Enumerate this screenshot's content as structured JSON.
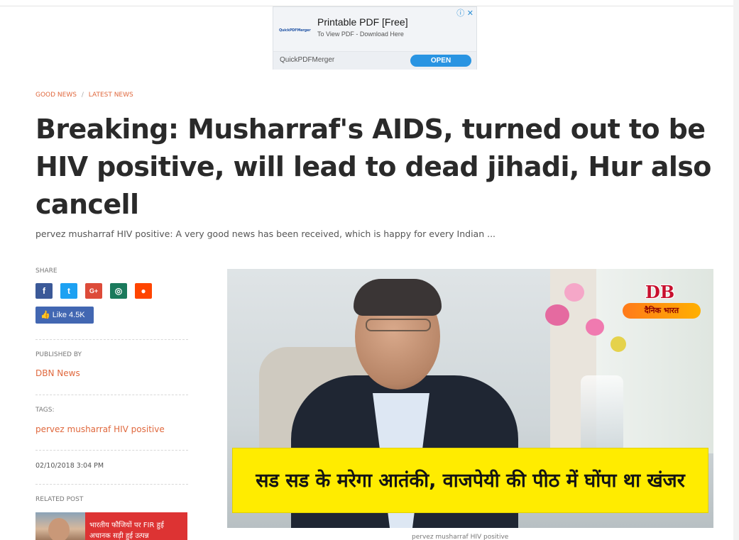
{
  "ad": {
    "logo_text": "QuickPDFMerger",
    "title": "Printable PDF [Free]",
    "subtitle": "To View PDF - Download Here",
    "info_icon": "info-icon",
    "close_icon": "close-icon",
    "brand": "QuickPDFMerger",
    "cta": "OPEN"
  },
  "breadcrumb": {
    "items": [
      "GOOD NEWS",
      "LATEST NEWS"
    ],
    "separator": "/"
  },
  "article": {
    "headline": "Breaking: Musharraf's AIDS, turned out to be HIV positive, will lead to dead jihadi, Hur also cancell",
    "summary": "pervez musharraf HIV positive: A very good news has been received, which is happy for every Indian ..."
  },
  "sidebar": {
    "share_label": "SHARE",
    "share_icons": [
      {
        "name": "facebook-icon",
        "glyph": "f",
        "color": "#3b5998"
      },
      {
        "name": "twitter-icon",
        "glyph": "t",
        "color": "#1da1f2"
      },
      {
        "name": "google-plus-icon",
        "glyph": "G+",
        "color": "#dd4b39"
      },
      {
        "name": "whatsapp-icon",
        "glyph": "◎",
        "color": "#1a7a5c"
      },
      {
        "name": "reddit-icon",
        "glyph": "●",
        "color": "#ff4500"
      }
    ],
    "like_label": "Like",
    "like_count": "4.5K",
    "published_by_label": "PUBLISHED BY",
    "publisher": "DBN News",
    "tags_label": "TAGS:",
    "tag": "pervez musharraf HIV positive",
    "date": "02/10/2018 3:04 PM",
    "related_label": "RELATED POST",
    "related_text": "भारतीय फौजियों पर FIR हुई अचानक सड़ी हुई उत्पन्न"
  },
  "hero": {
    "logo_db": "DB",
    "logo_band": "दैनिक भारत",
    "caption": "सड सड के मरेगा आतंकी, वाजपेयी की पीठ में घोंपा था खंजर"
  },
  "image_caption": "pervez musharraf HIV positive"
}
